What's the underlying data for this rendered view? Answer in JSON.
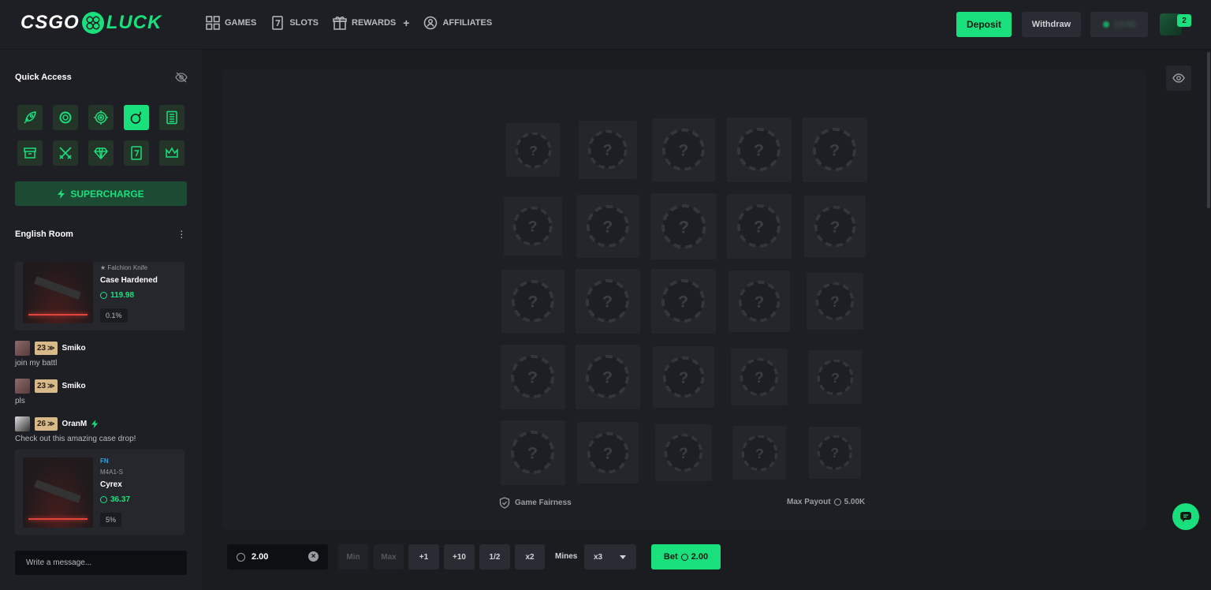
{
  "header": {
    "logo_left": "CSGO",
    "logo_right": "LUCK",
    "nav": [
      {
        "label": "GAMES",
        "icon": "grid-icon"
      },
      {
        "label": "SLOTS",
        "icon": "slot-seven-icon"
      },
      {
        "label": "REWARDS",
        "icon": "gift-icon"
      },
      {
        "label": "AFFILIATES",
        "icon": "affiliates-icon"
      }
    ],
    "rewards_plus": "+",
    "deposit_label": "Deposit",
    "withdraw_label": "Withdraw",
    "balance_hidden": "13.00",
    "notification_count": "2"
  },
  "sidebar": {
    "quick_access_title": "Quick Access",
    "quick_access_icons": [
      "rocket-icon",
      "roulette-icon",
      "target-icon",
      "mines-icon",
      "case-list-icon",
      "box-icon",
      "battle-icon",
      "diamond-icon",
      "slot-seven-icon",
      "crown-icon"
    ],
    "quick_access_active_index": 3,
    "supercharge_label": "SUPERCHARGE",
    "room_title": "English Room",
    "chat_items": [
      {
        "type": "drop",
        "sub": "★ Falchion Knife",
        "name": "Case Hardened",
        "price": "119.98",
        "pct": "0.1%"
      },
      {
        "type": "msg",
        "level": "23",
        "user": "Smiko",
        "text": "join my battl"
      },
      {
        "type": "msg",
        "level": "23",
        "user": "Smiko",
        "text": "pls"
      },
      {
        "type": "msg",
        "level": "26",
        "user": "OranM",
        "text": "Check out this amazing case drop!"
      },
      {
        "type": "drop",
        "quality": "FN",
        "sub": "M4A1-S",
        "name": "Cyrex",
        "price": "36.37",
        "pct": "5%"
      }
    ],
    "chat_placeholder": "Write a message..."
  },
  "board": {
    "tile_symbol": "?",
    "rows": 5,
    "cols": 5,
    "fairness_label": "Game Fairness",
    "max_payout_label": "Max Payout",
    "max_payout_value": "5.00K"
  },
  "controls": {
    "bet_amount": "2.00",
    "min_label": "Min",
    "max_label": "Max",
    "plus1_label": "+1",
    "plus10_label": "+10",
    "half_label": "1/2",
    "double_label": "x2",
    "mines_label": "Mines",
    "mines_value": "x3",
    "bet_button_label": "Bet",
    "bet_button_amount": "2.00"
  },
  "colors": {
    "accent": "#19e07c",
    "bg": "#1b1c20",
    "panel": "#1e1f24"
  }
}
